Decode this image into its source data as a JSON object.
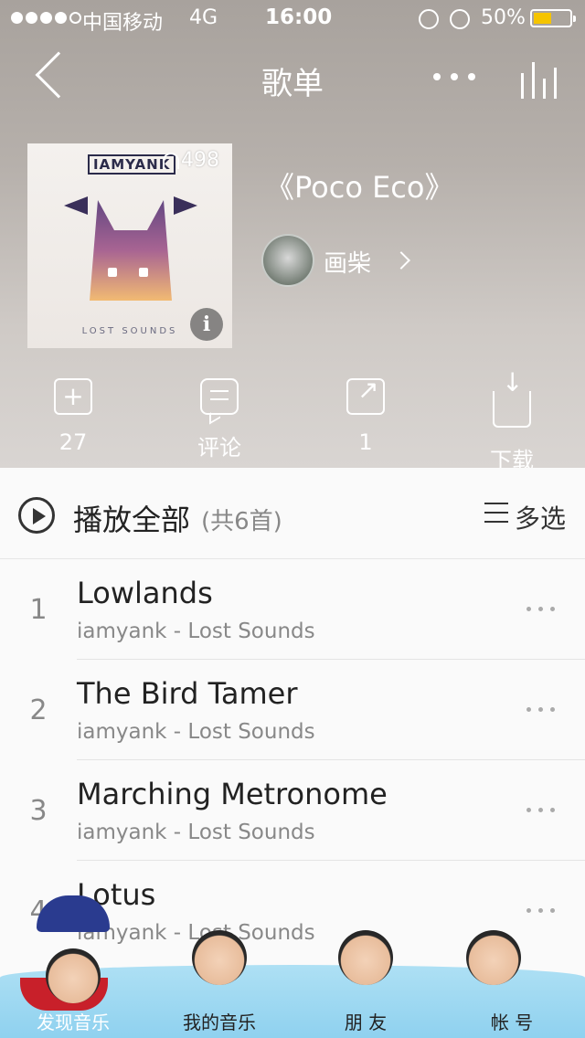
{
  "status_bar": {
    "carrier": "中国移动",
    "network": "4G",
    "time": "16:00",
    "battery_percent": "50%",
    "battery_level": 0.5
  },
  "nav": {
    "title": "歌单"
  },
  "playlist": {
    "play_count": "498",
    "cover_logo": "IAMYANK",
    "cover_subtitle": "LOST SOUNDS",
    "title": "《Poco Eco》",
    "creator": "画柴"
  },
  "actions": [
    {
      "label": "27",
      "icon": "folder-add-icon"
    },
    {
      "label": "评论",
      "icon": "comment-icon"
    },
    {
      "label": "1",
      "icon": "share-icon"
    },
    {
      "label": "下载",
      "icon": "download-icon"
    }
  ],
  "list_header": {
    "play_all": "播放全部",
    "count": "(共6首)",
    "multi_select": "多选"
  },
  "songs": [
    {
      "num": "1",
      "title": "Lowlands",
      "sub": "iamyank - Lost Sounds"
    },
    {
      "num": "2",
      "title": "The Bird Tamer",
      "sub": "iamyank - Lost Sounds"
    },
    {
      "num": "3",
      "title": "Marching Metronome",
      "sub": "iamyank - Lost Sounds"
    },
    {
      "num": "4",
      "title": "Lotus",
      "sub": "iamyank - Lost Sounds"
    }
  ],
  "tabs": [
    {
      "label": "发现音乐",
      "active": true
    },
    {
      "label": "我的音乐",
      "active": false
    },
    {
      "label": "朋 友",
      "active": false
    },
    {
      "label": "帐 号",
      "active": false
    }
  ],
  "colors": {
    "battery_fill": "#f5c400",
    "tabbar_water": "#8fd1ef"
  }
}
